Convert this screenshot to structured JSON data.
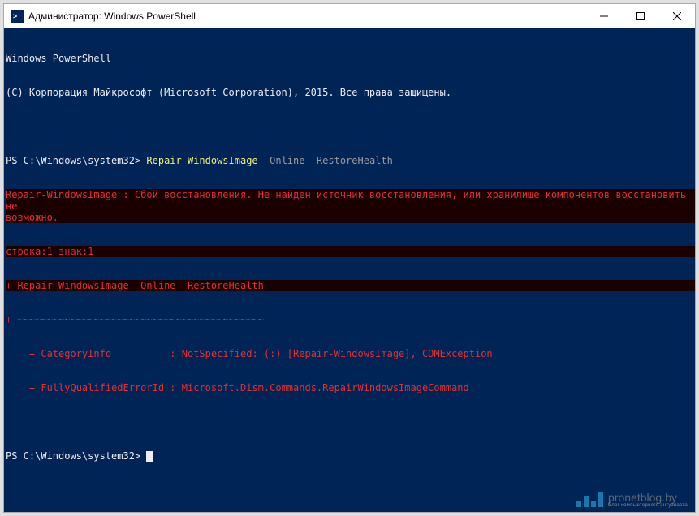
{
  "window": {
    "icon_text": ">_",
    "title": "Администратор: Windows PowerShell"
  },
  "terminal": {
    "header_line1": "Windows PowerShell",
    "header_line2": "(C) Корпорация Майкрософт (Microsoft Corporation), 2015. Все права защищены.",
    "prompt1_prefix": "PS C:\\Windows\\system32> ",
    "prompt1_cmd": "Repair-WindowsImage",
    "prompt1_params": " -Online -RestoreHealth",
    "error_msg": "Repair-WindowsImage : Сбой восстановления. Не найден источник восстановления, или хранилище компонентов восстановить не\nвозможно.",
    "error_loc": "строка:1 знак:1",
    "error_cmd_echo": "+ Repair-WindowsImage -Online -RestoreHealth",
    "error_underline": "+ ~~~~~~~~~~~~~~~~~~~~~~~~~~~~~~~~~~~~~~~~~~",
    "error_category": "    + CategoryInfo          : NotSpecified: (:) [Repair-WindowsImage], COMException",
    "error_fqid": "    + FullyQualifiedErrorId : Microsoft.Dism.Commands.RepairWindowsImageCommand",
    "blank": " ",
    "prompt2_prefix": "PS C:\\Windows\\system32> "
  },
  "watermark": {
    "main": "pronetblog.by",
    "sub": "Блог компьютерного энтузиаста"
  }
}
